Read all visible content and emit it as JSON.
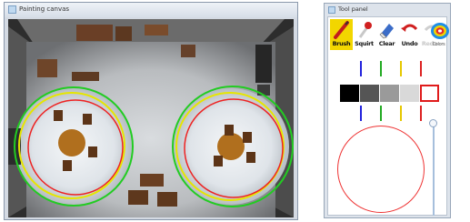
{
  "canvas_window": {
    "title": "Painting canvas"
  },
  "tool_window": {
    "title": "Tool panel",
    "tools": [
      {
        "name": "brush",
        "label": "Brush",
        "icon": "brush-icon",
        "selected": true
      },
      {
        "name": "squirt",
        "label": "Squirt",
        "icon": "squirt-icon"
      },
      {
        "name": "clear",
        "label": "Clear",
        "icon": "clear-icon"
      },
      {
        "name": "undo",
        "label": "Undo",
        "icon": "undo-icon"
      },
      {
        "name": "redo",
        "label": "Redo",
        "icon": "redo-icon",
        "disabled": true
      },
      {
        "name": "colors",
        "label": "Colors",
        "icon": "color-wheel-icon"
      }
    ],
    "swatches": [
      "#000000",
      "#555555",
      "#9a9a9a",
      "#d9d9d9",
      "#ffffff"
    ],
    "selected_swatch_index": 4,
    "marker_colors": [
      "#2222dd",
      "#22aa22",
      "#e6c800",
      "#dd2222"
    ],
    "brush_preview_color": "#ee3333"
  },
  "colors": {
    "accent_yellow": "#f2d600",
    "ring_green": "#22cc22",
    "ring_yellow": "#e6e600",
    "ring_red": "#ee2222"
  }
}
